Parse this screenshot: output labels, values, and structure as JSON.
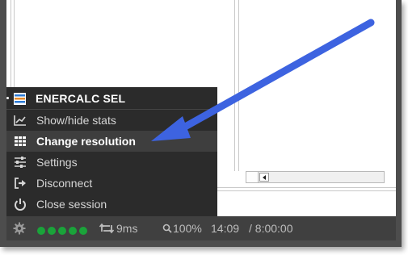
{
  "menu": {
    "title": "ENERCALC SEL",
    "items": [
      {
        "label": "Show/hide stats",
        "icon": "stats-icon",
        "active": false
      },
      {
        "label": "Change resolution",
        "icon": "grid-icon",
        "active": true
      },
      {
        "label": "Settings",
        "icon": "sliders-icon",
        "active": false
      },
      {
        "label": "Disconnect",
        "icon": "disconnect-icon",
        "active": false
      },
      {
        "label": "Close session",
        "icon": "power-icon",
        "active": false
      }
    ]
  },
  "status": {
    "signal_bars": 5,
    "signal_color": "#1aa33a",
    "latency": "9ms",
    "zoom": "100%",
    "time": "14:09",
    "duration": "/ 8:00:00"
  },
  "colors": {
    "menu_bg": "#2b2b2b",
    "status_bg": "#404040",
    "annotation_arrow": "#3d63e0"
  }
}
